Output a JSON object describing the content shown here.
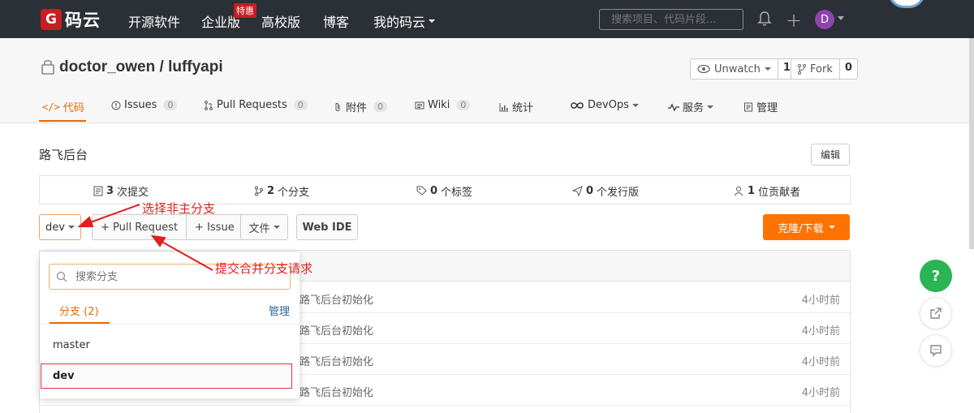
{
  "topnav": {
    "logo_mark": "G",
    "logo_text": "码云",
    "items": [
      "开源软件",
      "企业版",
      "高校版",
      "博客",
      "我的码云"
    ],
    "hot_badge": "特惠",
    "search_placeholder": "搜索项目、代码片段...",
    "avatar_letter": "D"
  },
  "repo": {
    "title": "doctor_owen / luffyapi",
    "unwatch_label": "Unwatch",
    "unwatch_count": "1",
    "fork_label": "Fork",
    "fork_count": "0"
  },
  "tabs": [
    {
      "label": "代码"
    },
    {
      "label": "Issues",
      "count": "0"
    },
    {
      "label": "Pull Requests",
      "count": "0"
    },
    {
      "label": "附件",
      "count": "0"
    },
    {
      "label": "Wiki",
      "count": "0"
    },
    {
      "label": "统计"
    },
    {
      "label": "DevOps"
    },
    {
      "label": "服务"
    },
    {
      "label": "管理"
    }
  ],
  "description": "路飞后台",
  "edit_label": "编辑",
  "stats": [
    {
      "num": "3",
      "label": "次提交"
    },
    {
      "num": "2",
      "label": "个分支"
    },
    {
      "num": "0",
      "label": "个标签"
    },
    {
      "num": "0",
      "label": "个发行版"
    },
    {
      "num": "1",
      "label": "位贡献者"
    }
  ],
  "toolbar": {
    "branch": "dev",
    "pull_request": "+ Pull Request",
    "issue": "+ Issue",
    "file": "文件",
    "web_ide": "Web IDE",
    "clone": "克隆/下载"
  },
  "commits": [
    {
      "msg": "路飞后台初始化",
      "time": "4小时前"
    },
    {
      "msg": "路飞后台初始化",
      "time": "4小时前"
    },
    {
      "msg": "路飞后台初始化",
      "time": "4小时前"
    },
    {
      "msg": "路飞后台初始化",
      "time": "4小时前"
    }
  ],
  "dropdown": {
    "search_placeholder": "搜索分支",
    "tab_label": "分支 (2)",
    "manage_label": "管理",
    "branches": [
      "master",
      "dev"
    ]
  },
  "annotations": {
    "choose_branch": "选择非主分支",
    "submit_pr": "提交合并分支请求"
  },
  "float": {
    "help": "?"
  },
  "colors": {
    "accent": "#e66a00",
    "clone_button": "#fe7300",
    "annotation": "#e02020",
    "help_button": "#2ab453"
  }
}
